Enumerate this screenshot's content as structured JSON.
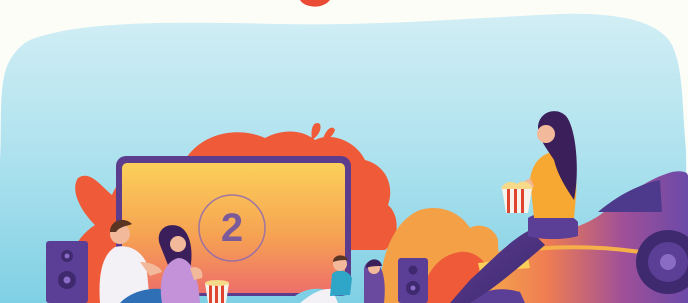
{
  "scene": {
    "countdown_number": "2"
  },
  "colors": {
    "sky_top": "#c6e9f2",
    "sky_bottom": "#7fd0e4",
    "blob_red": "#ef5a38",
    "blob_orange": "#f3a046",
    "screen_frame": "#5c3c8c",
    "screen_top": "#fbd05a",
    "screen_bottom": "#ee6f6a",
    "speaker": "#5b3e96",
    "car_purple": "#6b49a8",
    "car_orange": "#f08a3c",
    "woman_top": "#f7a833",
    "hair": "#3b1f5a",
    "popcorn_red": "#e0442e"
  },
  "icons": {
    "countdown": "countdown-circle-icon",
    "popcorn": "popcorn-bucket-icon",
    "speaker": "speaker-icon",
    "car": "car-icon"
  }
}
